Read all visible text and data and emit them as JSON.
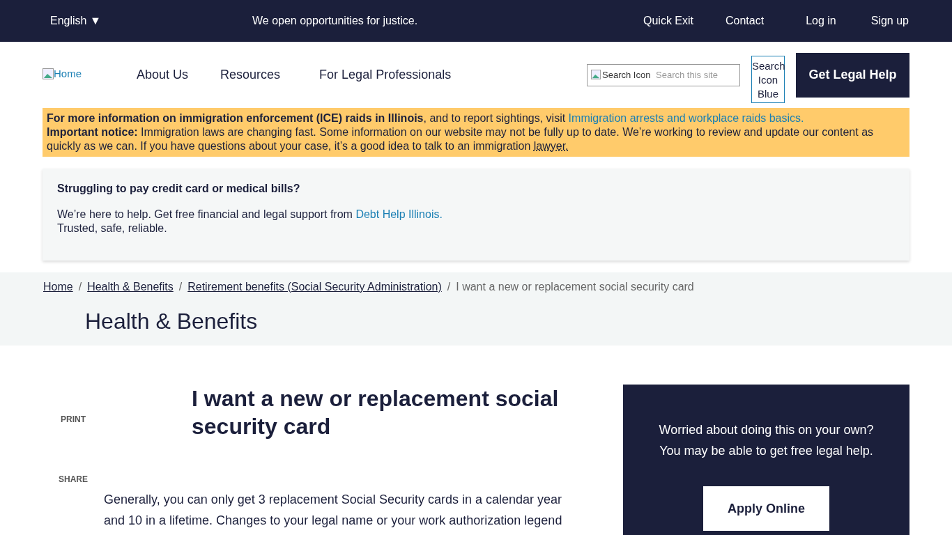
{
  "top_bar": {
    "language": "English ▼",
    "tagline": "We open opportunities for justice.",
    "links": [
      "Quick Exit",
      "Contact",
      "Log in",
      "Sign up"
    ]
  },
  "header": {
    "logo_alt": "Home",
    "nav": [
      "About Us",
      "Resources",
      "For Legal Professionals"
    ],
    "search": {
      "icon_alt": "Search Icon",
      "placeholder": "Search this site"
    },
    "search_button_alt": "Search Icon Blue",
    "cta": "Get Legal Help"
  },
  "alert": {
    "lines": [
      {
        "parts": [
          {
            "text": "**For more information on immigration enforcement (ICE) raids in Illinois**, and to report sightings, visit ",
            "kind": "text"
          },
          {
            "text": "Immigration arrests and workplace raids basics.",
            "kind": "link"
          }
        ]
      },
      {
        "parts": [
          {
            "text": "**Important notice:** Immigration laws are changing fast. Some information on our website may not be fully up to date. We’re working to review and update our content as quickly as we can. If you have questions about your case, it’s a good idea to talk to an immigration ",
            "kind": "text"
          },
          {
            "text": "lawyer.",
            "kind": "term"
          }
        ]
      }
    ]
  },
  "promo": {
    "title": "Struggling to pay credit card or medical bills?",
    "text": "We’re here to help. Get free financial and legal support from ",
    "link": "Debt Help Illinois.",
    "text2": "Trusted, safe, reliable."
  },
  "breadcrumb": {
    "items": [
      {
        "label": "Home",
        "separator": "/"
      },
      {
        "label": "Health & Benefits",
        "separator": "/"
      },
      {
        "label": "Retirement benefits (Social Security Administration)",
        "separator": "/"
      }
    ],
    "current": "I want a new or replacement social security card"
  },
  "section_title": "Health & Benefits",
  "tools": [
    "PRINT",
    "SHARE"
  ],
  "article": {
    "title": "I want a new or replacement social security card",
    "body": "Generally, you can only get 3 replacement Social Security cards in a calendar year and 10 in a lifetime. Changes to your legal name or your work authorization legend"
  },
  "sidebar": {
    "lines": [
      "Worried about doing this on your own?",
      "You may be able to get free legal help."
    ],
    "button": "Apply Online"
  }
}
